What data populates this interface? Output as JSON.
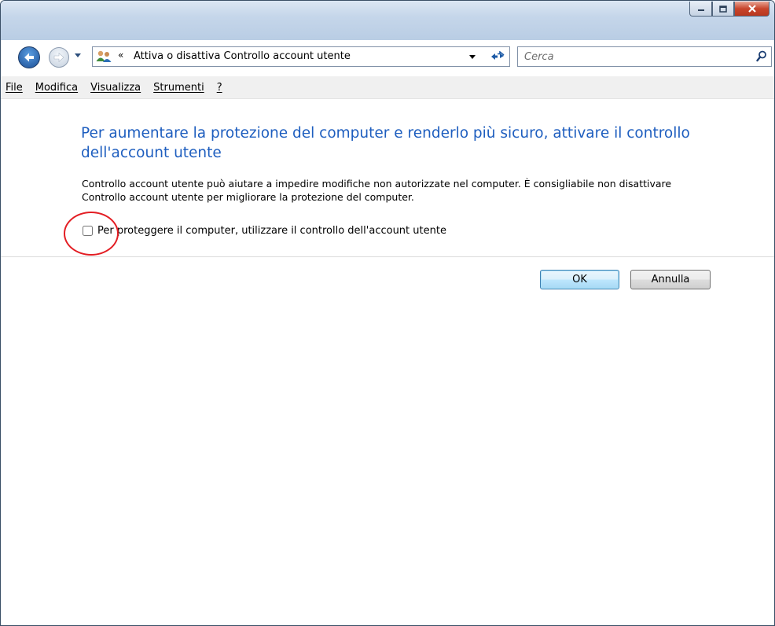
{
  "window": {
    "caption_buttons": {
      "minimize": "minimize-icon",
      "maximize": "maximize-icon",
      "close": "close-icon"
    }
  },
  "navigation": {
    "back_icon": "back-arrow-icon",
    "forward_icon": "forward-arrow-icon",
    "address": {
      "icon": "user-accounts-icon",
      "chevron": "«",
      "text": "Attiva o disattiva Controllo account utente"
    },
    "search": {
      "placeholder": "Cerca"
    }
  },
  "menu": {
    "items": [
      {
        "label": "File"
      },
      {
        "label": "Modifica"
      },
      {
        "label": "Visualizza"
      },
      {
        "label": "Strumenti"
      },
      {
        "label": "?"
      }
    ]
  },
  "content": {
    "title": "Per aumentare la protezione del computer e renderlo più sicuro, attivare il controllo dell'account utente",
    "description": "Controllo account utente può aiutare a impedire modifiche non autorizzate nel computer. È consigliabile non disattivare Controllo account utente per migliorare la protezione del computer.",
    "checkbox": {
      "label": "Per proteggere il computer, utilizzare il controllo dell'account utente",
      "checked": false
    },
    "annotation_color": "#e31e24",
    "title_color": "#1e5ebf"
  },
  "buttons": {
    "ok": "OK",
    "cancel": "Annulla"
  }
}
